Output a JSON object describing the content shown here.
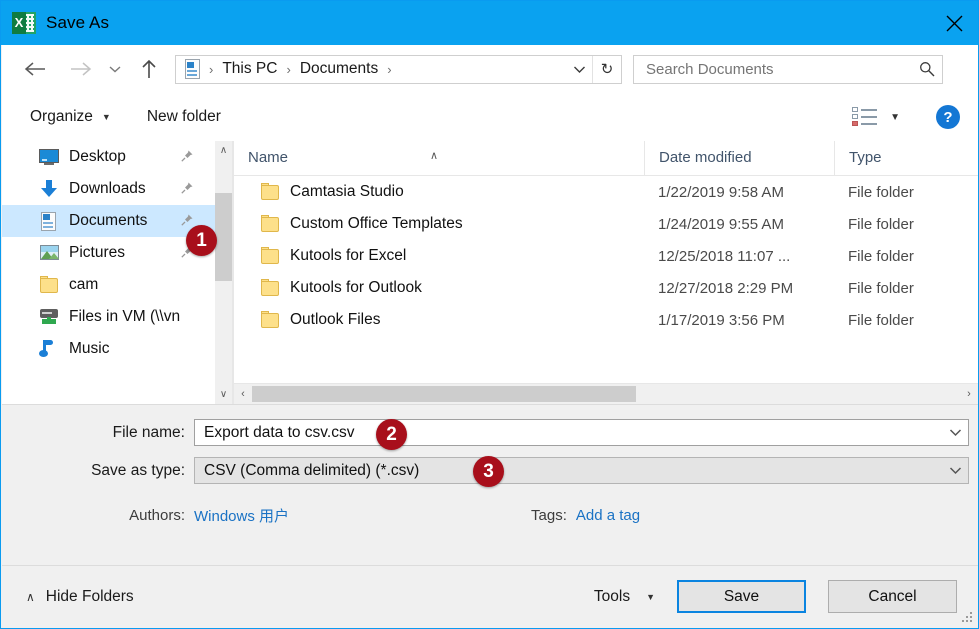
{
  "window": {
    "title": "Save As",
    "app_icon": "excel-icon",
    "excel_letter": "X",
    "close_label": "✕",
    "accent_color": "#0aa2f0",
    "badge_color": "#a80f1b"
  },
  "nav": {
    "back": "←",
    "forward": "→",
    "recent": "⌄",
    "up": "↑"
  },
  "address": {
    "icon": "documents-icon",
    "separator": "›",
    "crumbs": [
      "This PC",
      "Documents"
    ],
    "dropdown": "⌄",
    "refresh": "↻"
  },
  "search": {
    "placeholder": "Search Documents",
    "value": "",
    "icon": "search-icon"
  },
  "commandbar": {
    "organize": "Organize",
    "organize_caret": "▼",
    "new_folder": "New folder",
    "view_caret": "▼",
    "help": "?"
  },
  "sidebar": {
    "scroll_up": "∧",
    "scroll_down": "∨",
    "items": [
      {
        "label": "Desktop",
        "icon": "desktop-icon",
        "pinned": true,
        "selected": false
      },
      {
        "label": "Downloads",
        "icon": "download-icon",
        "pinned": true,
        "selected": false
      },
      {
        "label": "Documents",
        "icon": "documents-icon",
        "pinned": true,
        "selected": true
      },
      {
        "label": "Pictures",
        "icon": "pictures-icon",
        "pinned": true,
        "selected": false
      },
      {
        "label": "cam",
        "icon": "folder-icon",
        "pinned": false,
        "selected": false
      },
      {
        "label": "Files in VM (\\\\vn",
        "icon": "network-drive-icon",
        "pinned": false,
        "selected": false
      },
      {
        "label": "Music",
        "icon": "music-icon",
        "pinned": false,
        "selected": false
      }
    ]
  },
  "filelist": {
    "columns": [
      "Name",
      "Date modified",
      "Type"
    ],
    "sort_indicator": "∧",
    "rows": [
      {
        "name": "Camtasia Studio",
        "date": "1/22/2019 9:58 AM",
        "type": "File folder"
      },
      {
        "name": "Custom Office Templates",
        "date": "1/24/2019 9:55 AM",
        "type": "File folder"
      },
      {
        "name": "Kutools for Excel",
        "date": "12/25/2018 11:07 ...",
        "type": "File folder"
      },
      {
        "name": "Kutools for Outlook",
        "date": "12/27/2018 2:29 PM",
        "type": "File folder"
      },
      {
        "name": "Outlook Files",
        "date": "1/17/2019 3:56 PM",
        "type": "File folder"
      }
    ],
    "hscroll_left": "‹",
    "hscroll_right": "›"
  },
  "form": {
    "filename_label": "File name:",
    "filename_value": "Export data to csv.csv",
    "savetype_label": "Save as type:",
    "savetype_value": "CSV (Comma delimited) (*.csv)",
    "combo_arrow": "⌄",
    "authors_label": "Authors:",
    "authors_value": "Windows 用户",
    "tags_label": "Tags:",
    "tags_value": "Add a tag"
  },
  "footer": {
    "hide_folders": "Hide Folders",
    "hide_caret": "∧",
    "tools": "Tools",
    "tools_caret": "▼",
    "save": "Save",
    "cancel": "Cancel"
  },
  "annotations": [
    {
      "number": "1"
    },
    {
      "number": "2"
    },
    {
      "number": "3"
    }
  ]
}
